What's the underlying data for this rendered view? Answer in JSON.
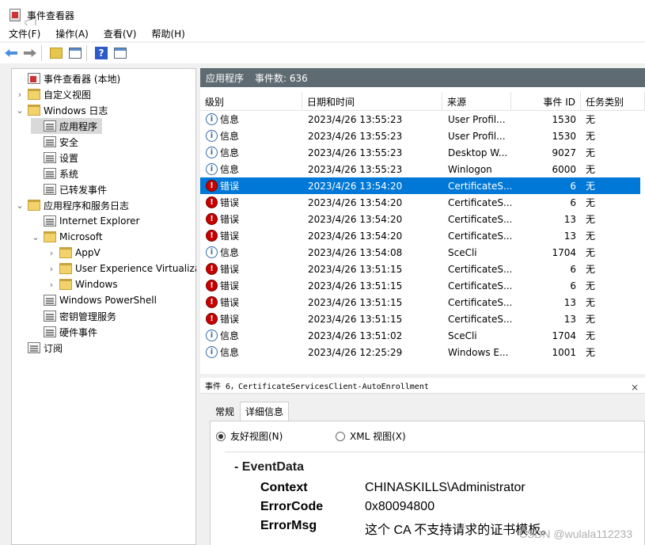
{
  "window": {
    "title": "事件查看器"
  },
  "menu": [
    "文件(F)",
    "操作(A)",
    "查看(V)",
    "帮助(H)"
  ],
  "toolbar": {
    "icons": [
      "back-arrow",
      "forward-arrow",
      "folder-up",
      "show-hide-console-tree",
      "help",
      "properties"
    ]
  },
  "tree": [
    {
      "label": "事件查看器 (本地)",
      "icon": "event-viewer",
      "caret": ""
    },
    {
      "label": "自定义视图",
      "icon": "folder",
      "caret": "›"
    },
    {
      "label": "Windows 日志",
      "icon": "folder",
      "caret": "⌄"
    },
    {
      "label": "应用程序",
      "icon": "log",
      "caret": ""
    },
    {
      "label": "安全",
      "icon": "log",
      "caret": ""
    },
    {
      "label": "设置",
      "icon": "log",
      "caret": ""
    },
    {
      "label": "系统",
      "icon": "log",
      "caret": ""
    },
    {
      "label": "已转发事件",
      "icon": "log",
      "caret": ""
    },
    {
      "label": "应用程序和服务日志",
      "icon": "folder",
      "caret": "⌄"
    },
    {
      "label": "Internet Explorer",
      "icon": "log",
      "caret": ""
    },
    {
      "label": "Microsoft",
      "icon": "folder",
      "caret": "⌄"
    },
    {
      "label": "AppV",
      "icon": "folder",
      "caret": "›"
    },
    {
      "label": "User Experience Virtualiza",
      "icon": "folder",
      "caret": "›"
    },
    {
      "label": "Windows",
      "icon": "folder",
      "caret": "›"
    },
    {
      "label": "Windows PowerShell",
      "icon": "log",
      "caret": ""
    },
    {
      "label": "密钥管理服务",
      "icon": "log",
      "caret": ""
    },
    {
      "label": "硬件事件",
      "icon": "log",
      "caret": ""
    },
    {
      "label": "订阅",
      "icon": "subscription",
      "caret": ""
    }
  ],
  "pane": {
    "log_name": "应用程序",
    "event_count": "事件数: 636"
  },
  "columns": [
    "级别",
    "日期和时间",
    "来源",
    "事件 ID",
    "任务类别"
  ],
  "events": [
    {
      "level": "信息",
      "datetime": "2023/4/26 13:55:23",
      "source": "User Profil...",
      "event_id": "1530",
      "category": "无"
    },
    {
      "level": "信息",
      "datetime": "2023/4/26 13:55:23",
      "source": "User Profil...",
      "event_id": "1530",
      "category": "无"
    },
    {
      "level": "信息",
      "datetime": "2023/4/26 13:55:23",
      "source": "Desktop W...",
      "event_id": "9027",
      "category": "无"
    },
    {
      "level": "信息",
      "datetime": "2023/4/26 13:55:23",
      "source": "Winlogon",
      "event_id": "6000",
      "category": "无"
    },
    {
      "level": "错误",
      "datetime": "2023/4/26 13:54:20",
      "source": "CertificateS...",
      "event_id": "6",
      "category": "无"
    },
    {
      "level": "错误",
      "datetime": "2023/4/26 13:54:20",
      "source": "CertificateS...",
      "event_id": "6",
      "category": "无"
    },
    {
      "level": "错误",
      "datetime": "2023/4/26 13:54:20",
      "source": "CertificateS...",
      "event_id": "13",
      "category": "无"
    },
    {
      "level": "错误",
      "datetime": "2023/4/26 13:54:20",
      "source": "CertificateS...",
      "event_id": "13",
      "category": "无"
    },
    {
      "level": "信息",
      "datetime": "2023/4/26 13:54:08",
      "source": "SceCli",
      "event_id": "1704",
      "category": "无"
    },
    {
      "level": "错误",
      "datetime": "2023/4/26 13:51:15",
      "source": "CertificateS...",
      "event_id": "6",
      "category": "无"
    },
    {
      "level": "错误",
      "datetime": "2023/4/26 13:51:15",
      "source": "CertificateS...",
      "event_id": "6",
      "category": "无"
    },
    {
      "level": "错误",
      "datetime": "2023/4/26 13:51:15",
      "source": "CertificateS...",
      "event_id": "13",
      "category": "无"
    },
    {
      "level": "错误",
      "datetime": "2023/4/26 13:51:15",
      "source": "CertificateS...",
      "event_id": "13",
      "category": "无"
    },
    {
      "level": "信息",
      "datetime": "2023/4/26 13:51:02",
      "source": "SceCli",
      "event_id": "1704",
      "category": "无"
    },
    {
      "level": "信息",
      "datetime": "2023/4/26 12:25:29",
      "source": "Windows E...",
      "event_id": "1001",
      "category": "无"
    }
  ],
  "selected_event_index": 4,
  "detail": {
    "title": "事件 6，CertificateServicesClient-AutoEnrollment",
    "tabs": [
      "常规",
      "详细信息"
    ],
    "active_tab": "详细信息",
    "views": [
      "友好视图(N)",
      "XML 视图(X)"
    ],
    "selected_view": "友好视图(N)",
    "section": "-  EventData",
    "fields": [
      {
        "key": "Context",
        "value": "CHINASKILLS\\Administrator"
      },
      {
        "key": "ErrorCode",
        "value": "0x80094800"
      },
      {
        "key": "ErrorMsg",
        "value": "这个 CA 不支持请求的证书模板。"
      }
    ]
  },
  "watermark": "CSDN @wulala112233"
}
